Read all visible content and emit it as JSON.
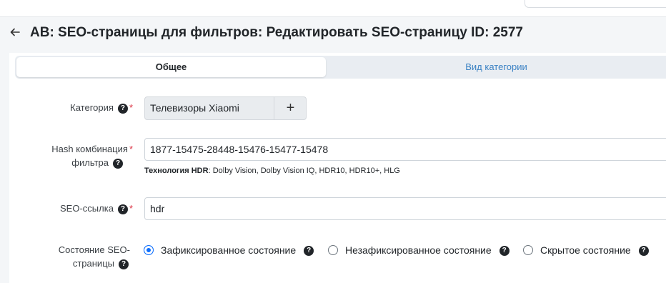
{
  "header": {
    "title": "AB: SEO-страницы для фильтров: Редактировать SEO-страницу ID: 2577"
  },
  "tabs": [
    {
      "label": "Общее",
      "active": true
    },
    {
      "label": "Вид категории",
      "active": false
    }
  ],
  "form": {
    "category": {
      "label": "Категория",
      "required_mark": "*",
      "help": "?",
      "value": "Телевизоры Xiaomi",
      "add_label": "+"
    },
    "hash": {
      "label_line1": "Hash комбинация",
      "label_line2": "фильтра",
      "required_mark": "*",
      "help": "?",
      "value": "1877-15475-28448-15476-15477-15478",
      "hint_name": "Технология HDR",
      "hint_values": ": Dolby Vision, Dolby Vision IQ, HDR10, HDR10+, HLG"
    },
    "seo_link": {
      "label": "SEO-ссылка",
      "required_mark": "*",
      "help": "?",
      "value": "hdr"
    },
    "state": {
      "label_line1": "Состояние SEO-",
      "label_line2": "страницы",
      "help": "?",
      "options": [
        {
          "label": "Зафиксированное состояние",
          "help": "?",
          "checked": true
        },
        {
          "label": "Незафиксированное состояние",
          "help": "?",
          "checked": false
        },
        {
          "label": "Скрытое состояние",
          "help": "?",
          "checked": false
        }
      ]
    }
  },
  "colors": {
    "accent": "#0d6efd",
    "tab_link": "#3b82c4",
    "required": "#dc3545",
    "background": "#f4f6f8"
  }
}
